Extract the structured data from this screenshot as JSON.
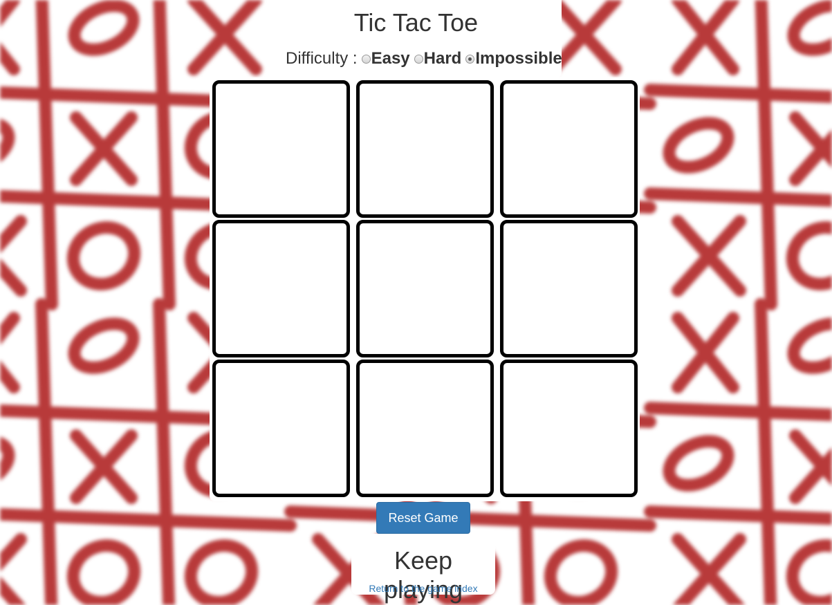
{
  "page": {
    "title": "Tic Tac Toe",
    "difficulty_label": "Difficulty :",
    "difficulty_options": [
      {
        "label": "Easy",
        "selected": false
      },
      {
        "label": "Hard",
        "selected": false
      },
      {
        "label": "Impossible",
        "selected": true
      }
    ],
    "reset_label": "Reset Game",
    "status": "Keep playing",
    "index_link": "Return to the game index"
  },
  "board": {
    "cells": [
      "",
      "",
      "",
      "",
      "",
      "",
      "",
      "",
      ""
    ]
  },
  "colors": {
    "accent": "#337ab7",
    "background_sketch": "#b83a3a",
    "cell_border": "#000000"
  }
}
